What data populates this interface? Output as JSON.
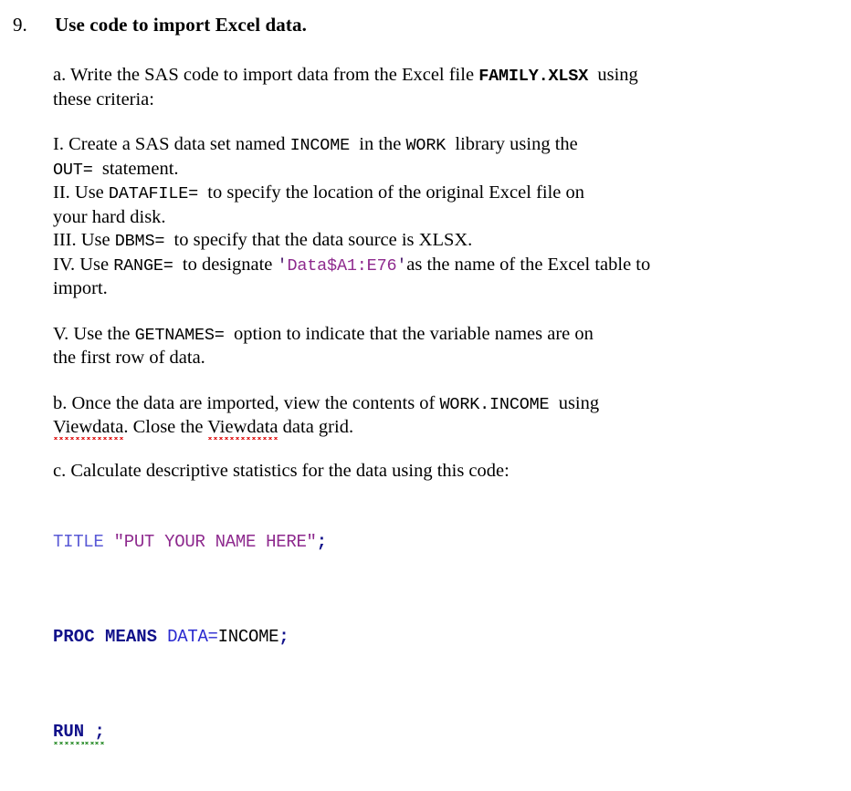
{
  "question": {
    "number": "9.",
    "title": "Use code to import Excel data."
  },
  "part_a": {
    "line1_pre": "a. Write the SAS code to import data from the Excel file ",
    "line1_code": "FAMILY.XLSX",
    "line1_post": "  using",
    "line2": "these criteria:"
  },
  "items": {
    "i": {
      "pre": "I. Create a SAS data set named ",
      "code1": "INCOME",
      "mid": "  in the ",
      "code2": "WORK",
      "post": "  library using the",
      "line2_code": "OUT=",
      "line2_post": "  statement."
    },
    "ii": {
      "pre": "II. Use ",
      "code1": "DATAFILE=",
      "post": "  to specify the location of the original Excel file on",
      "line2": "your hard disk."
    },
    "iii": {
      "pre": "III. Use ",
      "code1": "DBMS=",
      "post": "  to specify that the data source is XLSX."
    },
    "iv": {
      "pre": "IV. Use ",
      "code1": "RANGE=",
      "mid": "  to designate ",
      "literal_open": "'",
      "literal": "Data$A1:E76",
      "literal_close": "'",
      "post": "as the name of the Excel table to",
      "line2": "import."
    },
    "v": {
      "pre": "V. Use the ",
      "code1": "GETNAMES=",
      "post": "  option to indicate that the variable names are on",
      "line2": "the first row of data."
    }
  },
  "part_b": {
    "line1_pre": "b. Once the data are imported, view the contents of ",
    "line1_code": "WORK.INCOME",
    "line1_post": "  using",
    "line2_word1": "Viewdata",
    "line2_mid": ". Close the ",
    "line2_word2": "Viewdata",
    "line2_post": " data grid."
  },
  "part_c": {
    "intro": "c. Calculate descriptive statistics for the data using this code:",
    "code": {
      "line1": {
        "stmt": "TITLE",
        "space": " ",
        "string": "\"PUT YOUR NAME HERE\"",
        "semi": ";"
      },
      "line2": {
        "proc": "PROC MEANS",
        "space": " ",
        "option": "DATA=",
        "value": "INCOME",
        "semi": ";"
      },
      "line3": {
        "run": "RUN",
        "space": " ",
        "semi": ";"
      }
    }
  },
  "colors": {
    "page_background": "#ffffff",
    "text": "#000000",
    "sas_statement": "#5a5ad6",
    "sas_string": "#8e2a8e",
    "sas_proc": "#11118a",
    "sas_option": "#2a2ad0",
    "spellcheck_red": "#e01b1b",
    "grammarcheck_green": "#2f8f2f"
  }
}
